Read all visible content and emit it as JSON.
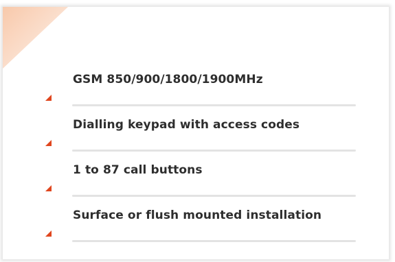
{
  "features": [
    {
      "label": "GSM 850/900/1800/1900MHz"
    },
    {
      "label": "Dialling keypad with access codes"
    },
    {
      "label": "1 to 87 call buttons"
    },
    {
      "label": "Surface or flush mounted installation"
    }
  ],
  "colors": {
    "bullet": "#e0461e",
    "corner": "#f8c9ab",
    "text": "#2e2e2e",
    "divider": "#e3e3e3"
  }
}
